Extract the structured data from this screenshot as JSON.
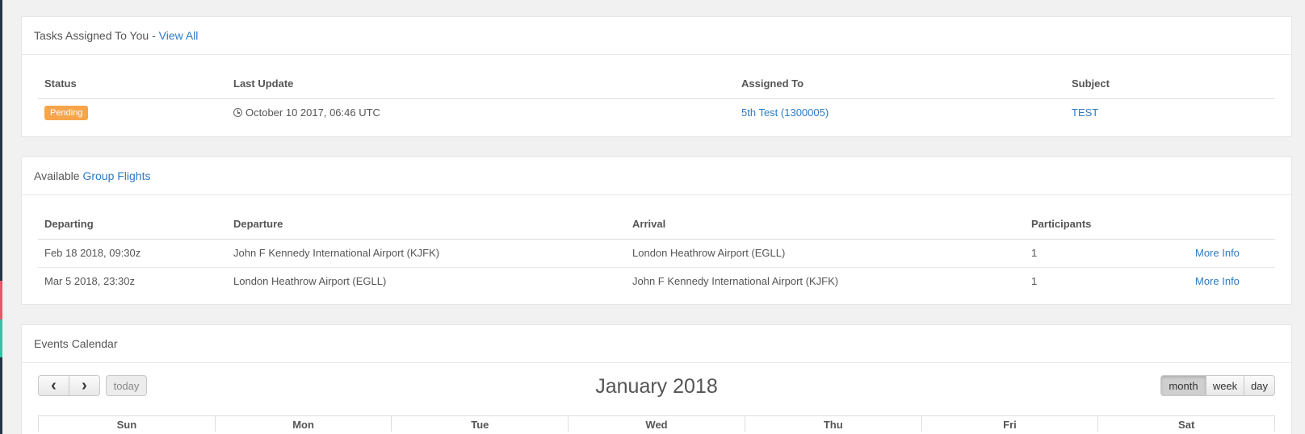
{
  "tasks": {
    "title": "Tasks Assigned To You - ",
    "view_all": "View All",
    "columns": [
      "Status",
      "Last Update",
      "Assigned To",
      "Subject"
    ],
    "rows": [
      {
        "status": "Pending",
        "last_update": "October 10 2017, 06:46 UTC",
        "assigned_to": "5th Test (1300005)",
        "subject": "TEST"
      }
    ]
  },
  "flights": {
    "title_prefix": "Available ",
    "title_link": "Group Flights",
    "columns": [
      "Departing",
      "Departure",
      "Arrival",
      "Participants",
      ""
    ],
    "rows": [
      {
        "departing": "Feb 18 2018, 09:30z",
        "departure": "John F Kennedy International Airport (KJFK)",
        "arrival": "London Heathrow Airport (EGLL)",
        "participants": "1",
        "action": "More Info"
      },
      {
        "departing": "Mar 5 2018, 23:30z",
        "departure": "London Heathrow Airport (EGLL)",
        "arrival": "John F Kennedy International Airport (KJFK)",
        "participants": "1",
        "action": "More Info"
      }
    ]
  },
  "calendar": {
    "title": "Events Calendar",
    "month_label": "January 2018",
    "prev_icon": "chevron-left-icon",
    "next_icon": "chevron-right-icon",
    "prev_glyph": "‹",
    "next_glyph": "›",
    "today_label": "today",
    "views": [
      "month",
      "week",
      "day"
    ],
    "active_view": "month",
    "days": [
      "Sun",
      "Mon",
      "Tue",
      "Wed",
      "Thu",
      "Fri",
      "Sat"
    ]
  }
}
